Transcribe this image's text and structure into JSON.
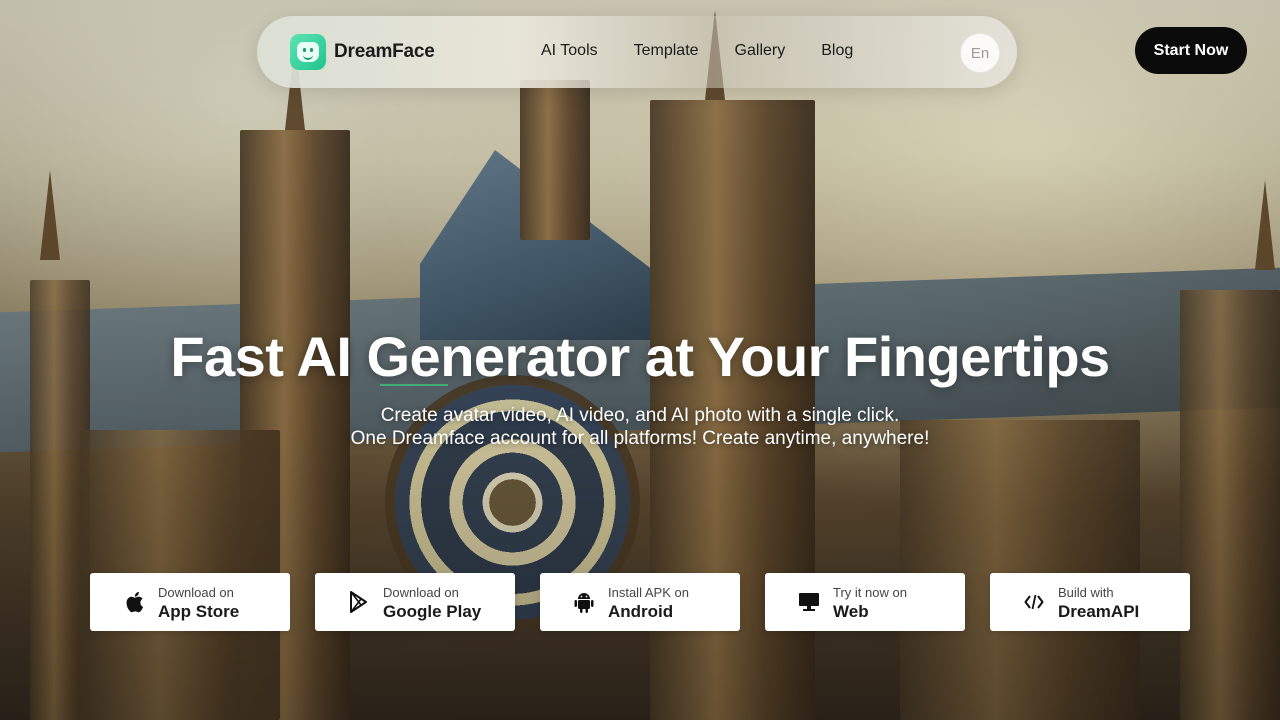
{
  "brand": {
    "name": "DreamFace",
    "accent": "#21c48e"
  },
  "nav": {
    "links": [
      {
        "label": "AI Tools"
      },
      {
        "label": "Template"
      },
      {
        "label": "Gallery"
      },
      {
        "label": "Blog"
      }
    ],
    "language": "En",
    "cta": "Start Now"
  },
  "hero": {
    "title": "Fast AI Generator at Your Fingertips",
    "subtitle_line1": "Create avatar video, AI video, and AI photo with a single click.",
    "subtitle_line2": "One Dreamface account for all platforms! Create anytime, anywhere!"
  },
  "downloads": [
    {
      "small": "Download on",
      "big": "App Store",
      "icon": "apple-icon"
    },
    {
      "small": "Download on",
      "big": "Google Play",
      "icon": "google-play-icon"
    },
    {
      "small": "Install APK on",
      "big": "Android",
      "icon": "android-icon"
    },
    {
      "small": "Try it now on",
      "big": "Web",
      "icon": "monitor-icon"
    },
    {
      "small": "Build with",
      "big": "DreamAPI",
      "icon": "code-icon"
    }
  ]
}
